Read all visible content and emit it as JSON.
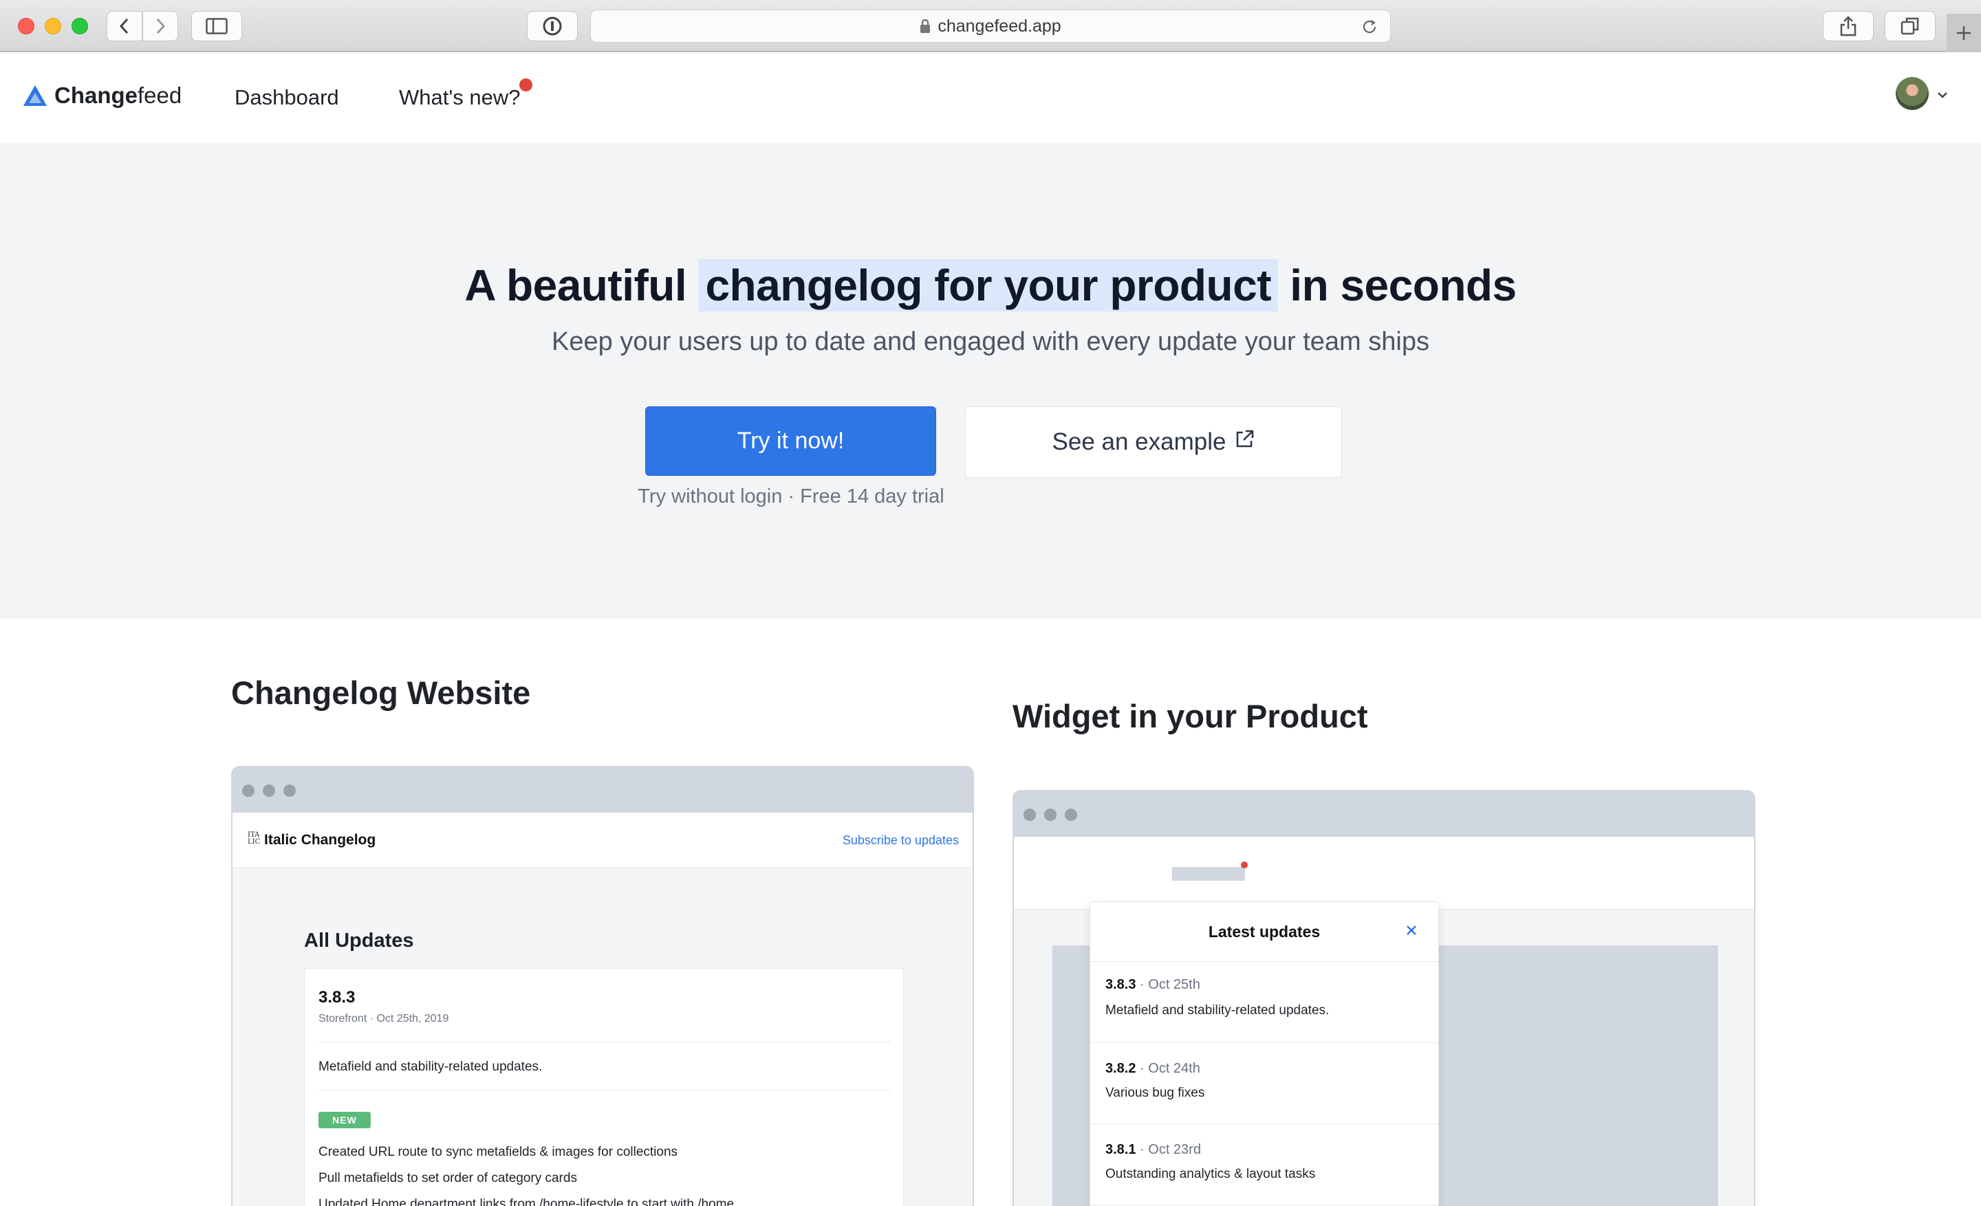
{
  "browser": {
    "url": "changefeed.app"
  },
  "nav": {
    "brand_bold": "Change",
    "brand_rest": "feed",
    "links": [
      "Dashboard",
      "What's new?"
    ]
  },
  "hero": {
    "title_before": "A beautiful ",
    "title_highlight": "changelog for your product",
    "title_after": " in seconds",
    "subtitle": "Keep your users up to date and engaged with every update your team ships",
    "primary_cta": "Try it now!",
    "secondary_cta": "See an example",
    "trial_note": "Try without login · Free 14 day trial"
  },
  "website_section": {
    "title": "Changelog Website",
    "site_logo": "ITA\nLIC",
    "site_name": "Italic Changelog",
    "subscribe": "Subscribe to updates",
    "heading": "All Updates",
    "entry": {
      "version": "3.8.3",
      "meta": "Storefront · Oct 25th, 2019",
      "summary": "Metafield and stability-related updates.",
      "badge": "NEW",
      "items": [
        "Created URL route to sync metafields & images for collections",
        "Pull metafields to set order of category cards",
        "Updated Home department links from /home-lifestyle to start with /home"
      ]
    }
  },
  "widget_section": {
    "title": "Widget in your Product",
    "popup_title": "Latest updates",
    "updates": [
      {
        "version": "3.8.3",
        "date": "· Oct 25th",
        "text": "Metafield and stability-related updates."
      },
      {
        "version": "3.8.2",
        "date": "· Oct 24th",
        "text": "Various bug fixes"
      },
      {
        "version": "3.8.1",
        "date": "· Oct 23rd",
        "text": "Outstanding analytics & layout tasks"
      }
    ]
  },
  "colors": {
    "primary": "#2e75e6",
    "highlight": "#dbe8fb",
    "hero_bg": "#f3f4f6",
    "badge_green": "#5dbb79",
    "notification_red": "#e0443e"
  }
}
